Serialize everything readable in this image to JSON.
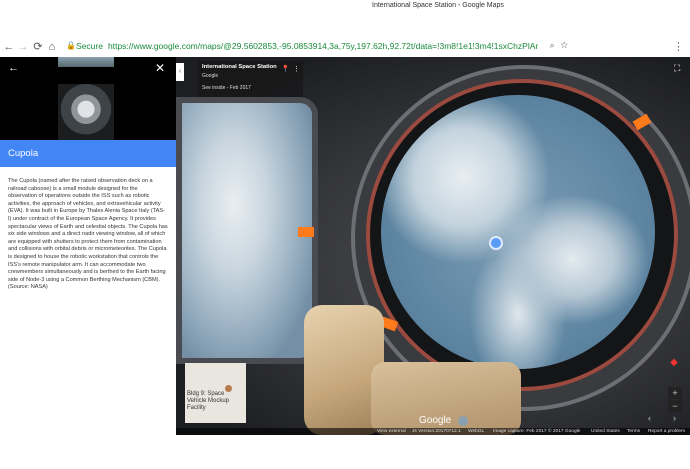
{
  "browser": {
    "tab_title": "International Space Station - Google Maps",
    "secure_label": "Secure",
    "url": "https://www.google.com/maps/@29.5602853,-95.0853914,3a,75y,197.62h,92.72t/data=!3m8!1e1!3m4!1sxChzPlAn4R...",
    "nav_icons": [
      "back-icon",
      "forward-icon",
      "reload-icon",
      "home-icon"
    ]
  },
  "panel": {
    "place_title": "Cupola",
    "description": "The Cupola (named after the raised observation deck on a railroad caboose) is a small module designed for the observation of operations outside the ISS such as robotic activities, the approach of vehicles, and extravehicular activity (EVA). It was built in Europe by Thales Alenia Space Italy (TAS-I) under contract of the European Space Agency. It provides spectacular views of Earth and celestial objects. The Cupola has six side windows and a direct nadir viewing window, all of which are equipped with shutters to protect them from contamination and collisions with orbital debris or micrometeorites. The Cupola is designed to house the robotic workstation that controls the ISS's remote manipulator arm. It can accommodate two crewmembers simultaneously and is berthed to the Earth facing side of Node-3 using a Common Berthing Mechanism (CBM). (Source: NASA)"
  },
  "streetview": {
    "title": "International Space Station",
    "subtitle": "Google",
    "see_inside": "See inside - Feb 2017",
    "minimap_label": "Bldg 9: Space Vehicle Mockup Facility",
    "logo_text": "Google"
  },
  "footer": {
    "view_external": "View external",
    "js_version": "Js Version:20170712.1",
    "webgl": "WebGL",
    "image_capture": "Image capture: Feb 2017",
    "copyright": "© 2017 Google",
    "country": "United States",
    "terms": "Terms",
    "report": "Report a problem"
  },
  "colors": {
    "accent": "#4285f4",
    "secure": "#1a8a3c",
    "clip": "#ff7a1a"
  }
}
